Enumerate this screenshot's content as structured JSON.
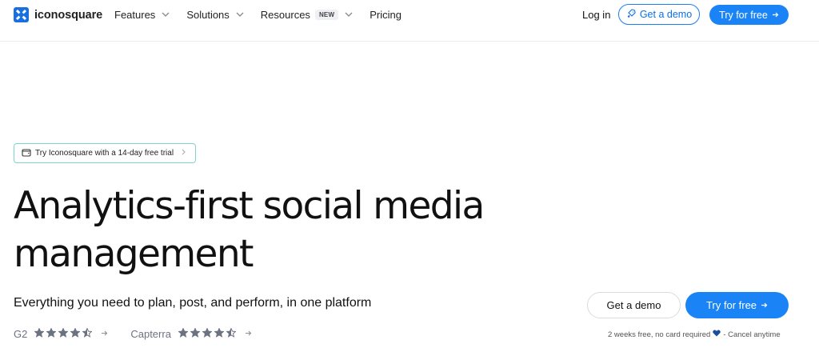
{
  "header": {
    "logo_text": "iconosquare",
    "nav": [
      {
        "label": "Features",
        "has_dropdown": true
      },
      {
        "label": "Solutions",
        "has_dropdown": true
      },
      {
        "label": "Resources",
        "badge": "NEW",
        "has_dropdown": true
      },
      {
        "label": "Pricing",
        "has_dropdown": false
      }
    ],
    "login_label": "Log in",
    "demo_label": "Get a demo",
    "try_label": "Try for free"
  },
  "hero": {
    "trial_badge": "Try Iconosquare with a 14-day free trial",
    "title_line1": "Analytics-first social media",
    "title_line2": "management",
    "subtitle": "Everything you need to plan, post, and perform, in one platform",
    "ratings": [
      {
        "name": "G2",
        "stars": 4.5
      },
      {
        "name": "Capterra",
        "stars": 4.5
      }
    ],
    "demo_label": "Get a demo",
    "try_label": "Try for free",
    "note_left": "2 weeks free, no card required",
    "note_right": "- Cancel anytime"
  },
  "colors": {
    "primary": "#1a84f6",
    "badge_border": "#7fd4cc",
    "star": "#6b7280"
  }
}
